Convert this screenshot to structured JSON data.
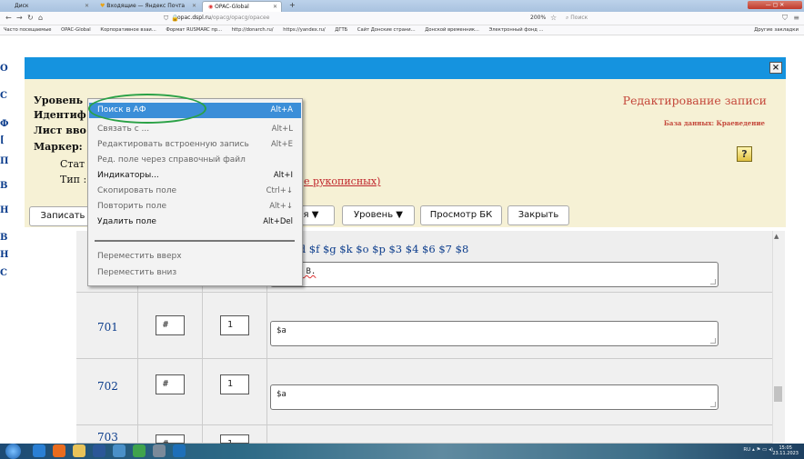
{
  "browser": {
    "tabs": [
      {
        "label": "Диск"
      },
      {
        "label": "Входящие — Яндекс Почта"
      },
      {
        "label": "OPAC-Global"
      }
    ],
    "new_tab": "+",
    "url_domain": "opac.dspl.ru",
    "url_path": "/opacg/opacg/opacee",
    "zoom": "200%",
    "search_placeholder": "Поиск",
    "bookmarks": [
      "Часто посещаемые",
      "OPAC-Global",
      "Корпоративное взаи...",
      "Формат RUSMARC пр...",
      "http://donarch.ru/",
      "https://yandex.ru/",
      "ДГТБ",
      "Сайт Донские страни...",
      "Донской временник...",
      "Электронный фонд ..."
    ],
    "other_bookmarks": "Другие закладки"
  },
  "left_letters": [
    "О",
    "С",
    "Ф",
    "[",
    "П",
    "В",
    "Н",
    "В",
    "Н",
    "С"
  ],
  "modal": {
    "close_label": "×",
    "title": "Редактирование записи",
    "database_label": "База данных: Краеведение",
    "help_icon_glyph": "?",
    "fields": {
      "level": "Уровень",
      "identifier": "Идентиф",
      "entry_sheet": "Лист вво",
      "marker": "Маркер:",
      "status": "Стат",
      "type": "Тип :"
    },
    "record_type_value": "е рукописных)",
    "buttons": {
      "save": "Записать",
      "menu_suffix": "я ▼",
      "level": "Уровень ▼",
      "view_bk": "Просмотр БК",
      "close": "Закрыть"
    }
  },
  "table": {
    "subfield_header": "$c $d $f $g $k $o $p $3 $4 $6 $7 $8",
    "first_value": "инова В.",
    "rows": [
      {
        "tag": "701",
        "ind1": "#",
        "ind2": "1",
        "value": "$a"
      },
      {
        "tag": "702",
        "ind1": "#",
        "ind2": "1",
        "value": "$a"
      },
      {
        "tag": "703",
        "ind1": "#",
        "ind2": "1",
        "value": ""
      }
    ]
  },
  "context_menu": {
    "items": [
      {
        "label": "Поиск в АФ",
        "shortcut": "Alt+A"
      },
      {
        "label": "Связать с ...",
        "shortcut": "Alt+L"
      },
      {
        "label": "Редактировать встроенную запись",
        "shortcut": "Alt+E"
      },
      {
        "label": "Ред. поле через справочный файл",
        "shortcut": ""
      },
      {
        "label": "Индикаторы...",
        "shortcut": "Alt+I"
      },
      {
        "label": "Скопировать поле",
        "shortcut": "Ctrl+↓"
      },
      {
        "label": "Повторить поле",
        "shortcut": "Alt+↓"
      },
      {
        "label": "Удалить поле",
        "shortcut": "Alt+Del"
      },
      {
        "label": "Переместить вверх",
        "shortcut": ""
      },
      {
        "label": "Переместить вниз",
        "shortcut": ""
      }
    ]
  },
  "taskbar": {
    "tray": "RU",
    "time": "15:05",
    "date": "23.11.2023"
  },
  "colors": {
    "modal_header": "#1593df",
    "modal_body": "#f6f1d5",
    "title_red": "#c4473a",
    "tag_blue": "#0b3c8c",
    "menu_selected": "#3b8ed8",
    "annotation_ring": "#2aa146"
  }
}
